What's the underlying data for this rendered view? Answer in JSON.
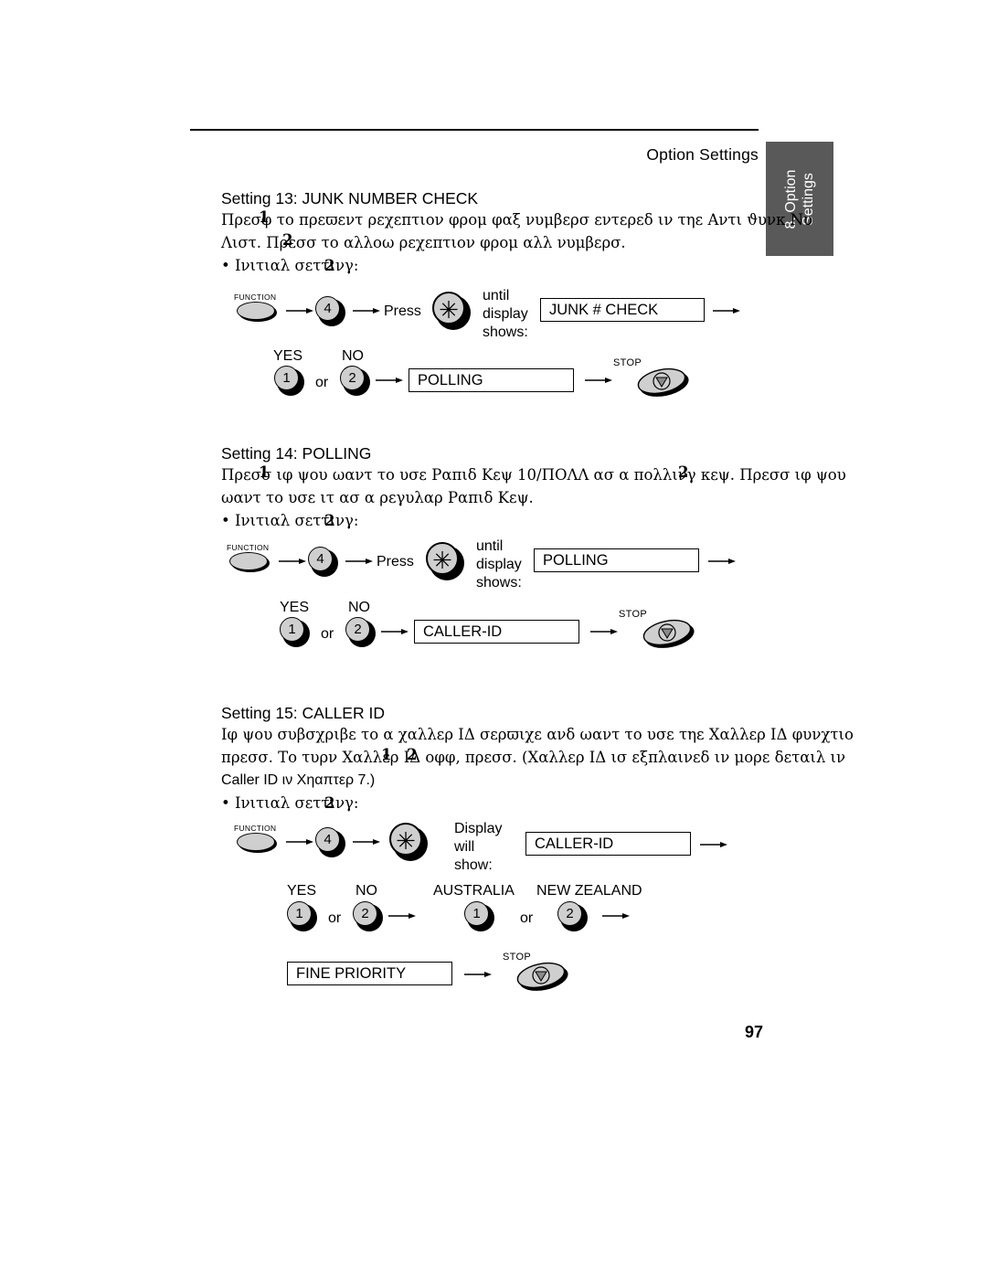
{
  "header": {
    "title": "Option Settings"
  },
  "side_tab": {
    "text": "8. Option\nSettings",
    "line1": "8. Option",
    "line2": "Settings",
    "bg_color": "#595959",
    "text_color": "#ffffff"
  },
  "page_number": "97",
  "sections": [
    {
      "title": "Setting 13: JUNK NUMBER CHECK",
      "body_lines": [
        "Πρεσφ το πρεϖεντ ρεχεπτιον φρομ φαξ νυμβερσ εντερεδ ιν τηε Αντι ϑυνκ Νυ",
        "Λιστ. Πρεσσ το αλλοω ρεχεπτιον φρομ αλλ νυμβερσ."
      ],
      "overlap_words": [
        "1",
        "2"
      ],
      "initial_setting_line": "• Ινιτιαλ σεττινγ:",
      "initial_setting_value": "2",
      "steps": [
        {
          "function_label": "FUNCTION",
          "key": "4",
          "press_label": "Press",
          "star_key": "✳",
          "until_label": "until\ndisplay\nshows:",
          "until_line1": "until",
          "until_line2": "display",
          "until_line3": "shows:",
          "display_value": "JUNK # CHECK"
        },
        {
          "yes_label": "YES",
          "no_label": "NO",
          "yes_key": "1",
          "or_label": "or",
          "no_key": "2",
          "display_value": "POLLING",
          "stop_label": "STOP"
        }
      ]
    },
    {
      "title": "Setting 14: POLLING",
      "body_lines": [
        "Πρεσσ ιφ ψου ωαντ το υσε Ραπιδ Κεψ 10/ΠΟΛΛ ασ α πολλινγ κεψ. Πρεσσ ιφ ψου",
        "ωαντ το υσε ιτ ασ α ρεγυλαρ Ραπιδ Κεψ."
      ],
      "overlap_words": [
        "1",
        "2"
      ],
      "initial_setting_line": "• Ινιτιαλ σεττινγ:",
      "initial_setting_value": "2",
      "steps": [
        {
          "function_label": "FUNCTION",
          "key": "4",
          "press_label": "Press",
          "star_key": "✳",
          "until_line1": "until",
          "until_line2": "display",
          "until_line3": "shows:",
          "display_value": "POLLING"
        },
        {
          "yes_label": "YES",
          "no_label": "NO",
          "yes_key": "1",
          "or_label": "or",
          "no_key": "2",
          "display_value": "CALLER-ID",
          "stop_label": "STOP"
        }
      ]
    },
    {
      "title": "Setting 15: CALLER ID",
      "body_lines": [
        "Ιφ ψου συβσχριβε το α χαλλερ ΙΔ σερϖιχε ανδ ωαντ το υσε τηε Χαλλερ ΙΔ φυνχτιο",
        "πρεσσ. Το τυρν Χαλλερ ΙΔ οφφ, πρεσσ. (Χαλλερ ΙΔ ισ εξπλαινεδ ιν μορε δεταιλ ιν",
        "Caller ID ιν Χηαπτερ 7.)"
      ],
      "overlap_words": [
        "1",
        "2"
      ],
      "initial_setting_line": "• Ινιτιαλ σεττινγ:",
      "initial_setting_value": "2",
      "steps": [
        {
          "function_label": "FUNCTION",
          "key": "4",
          "star_key": "✳",
          "display_line1": "Display",
          "display_line2": "will",
          "display_line3": "show:",
          "display_value": "CALLER-ID"
        },
        {
          "yes_label": "YES",
          "no_label": "NO",
          "yes_key": "1",
          "or_label": "or",
          "no_key": "2",
          "australia_label": "AUSTRALIA",
          "new_zealand_label": "NEW ZEALAND",
          "australia_key": "1",
          "or_label_2": "or",
          "new_zealand_key": "2"
        },
        {
          "display_value": "FINE PRIORITY",
          "stop_label": "STOP"
        }
      ]
    }
  ]
}
